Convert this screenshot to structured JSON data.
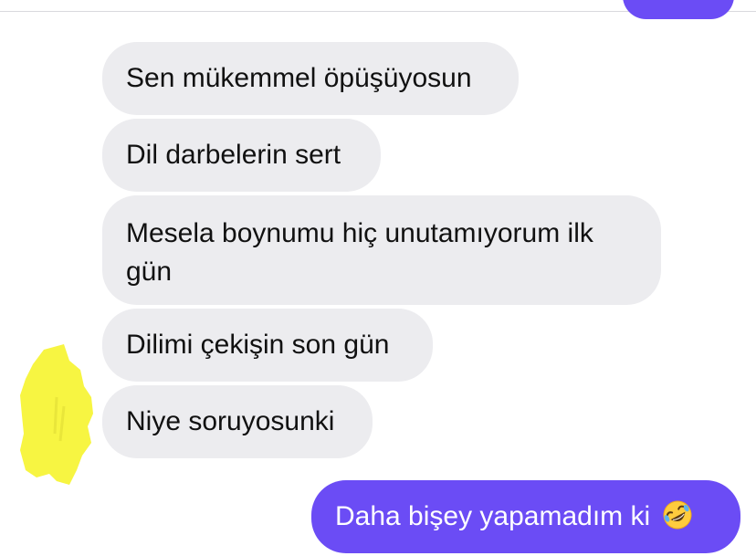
{
  "chat": {
    "received": [
      "Sen mükemmel öpüşüyosun",
      "Dil darbelerin sert",
      "Mesela boynumu hiç unutamıyorum ilk gün",
      "Dilimi çekişin son gün",
      "Niye soruyosunki"
    ],
    "sent": {
      "text": "Daha bişey yapamadım ki",
      "emoji": "rolling-on-floor-laughing-emoji"
    }
  },
  "colors": {
    "sent_bubble": "#6b4cf5",
    "received_bubble": "#ececef",
    "highlight": "#f7f542"
  }
}
